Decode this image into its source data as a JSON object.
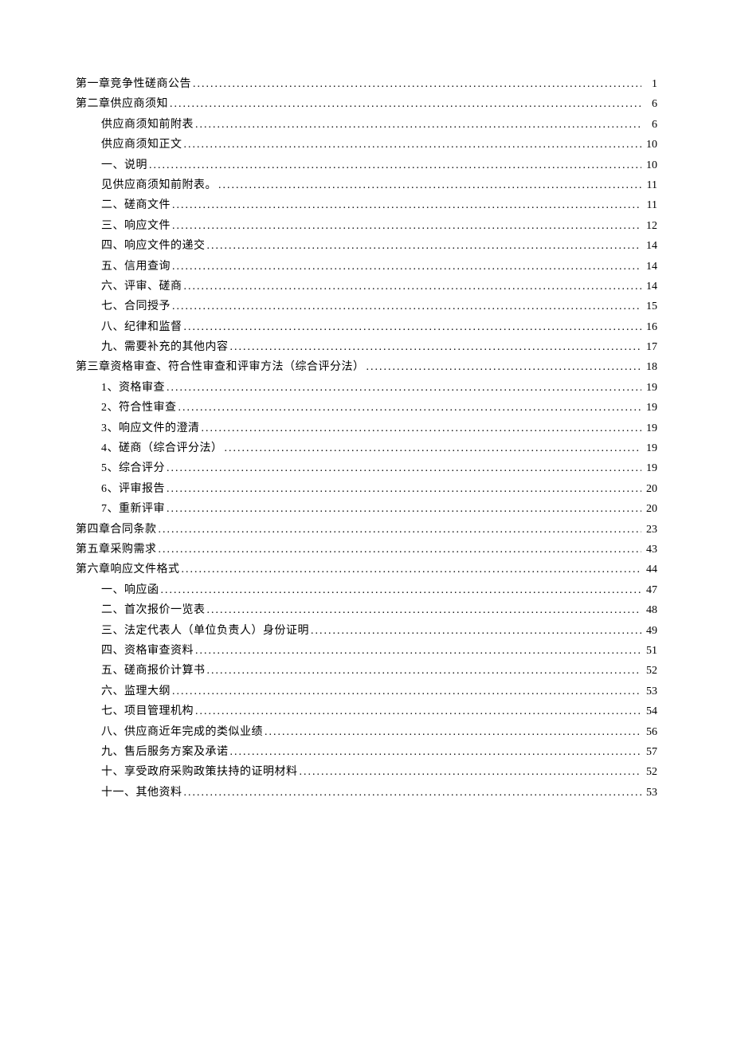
{
  "toc": [
    {
      "level": 0,
      "title": "第一章竞争性磋商公告",
      "page": "1"
    },
    {
      "level": 0,
      "title": "第二章供应商须知",
      "page": "6"
    },
    {
      "level": 1,
      "title": "供应商须知前附表",
      "page": "6"
    },
    {
      "level": 1,
      "title": "供应商须知正文",
      "page": "10"
    },
    {
      "level": 1,
      "title": "一、说明",
      "page": "10"
    },
    {
      "level": 1,
      "title": "见供应商须知前附表。",
      "page": "11"
    },
    {
      "level": 1,
      "title": "二、磋商文件",
      "page": "11"
    },
    {
      "level": 1,
      "title": "三、响应文件",
      "page": "12"
    },
    {
      "level": 1,
      "title": "四、响应文件的递交",
      "page": "14"
    },
    {
      "level": 1,
      "title": "五、信用查询",
      "page": "14"
    },
    {
      "level": 1,
      "title": "六、评审、磋商",
      "page": "14"
    },
    {
      "level": 1,
      "title": "七、合同授予",
      "page": "15"
    },
    {
      "level": 1,
      "title": "八、纪律和监督",
      "page": "16"
    },
    {
      "level": 1,
      "title": "九、需要补充的其他内容",
      "page": "17"
    },
    {
      "level": 0,
      "title": "第三章资格审查、符合性审查和评审方法（综合评分法）",
      "page": "18"
    },
    {
      "level": 1,
      "title": "1、资格审查",
      "page": "19"
    },
    {
      "level": 1,
      "title": "2、符合性审查",
      "page": "19"
    },
    {
      "level": 1,
      "title": "3、响应文件的澄清",
      "page": "19"
    },
    {
      "level": 1,
      "title": "4、磋商（综合评分法）",
      "page": "19"
    },
    {
      "level": 1,
      "title": "5、综合评分",
      "page": "19"
    },
    {
      "level": 1,
      "title": "6、评审报告",
      "page": "20"
    },
    {
      "level": 1,
      "title": "7、重新评审",
      "page": "20"
    },
    {
      "level": 0,
      "title": "第四章合同条款",
      "page": "23"
    },
    {
      "level": 0,
      "title": "第五章采购需求",
      "page": "43"
    },
    {
      "level": 0,
      "title": "第六章响应文件格式",
      "page": "44"
    },
    {
      "level": 1,
      "title": "一、响应函",
      "page": "47"
    },
    {
      "level": 1,
      "title": "二、首次报价一览表",
      "page": "48"
    },
    {
      "level": 1,
      "title": "三、法定代表人（单位负责人）身份证明",
      "page": "49"
    },
    {
      "level": 1,
      "title": "四、资格审查资料",
      "page": "51"
    },
    {
      "level": 1,
      "title": "五、磋商报价计算书",
      "page": "52"
    },
    {
      "level": 1,
      "title": "六、监理大纲",
      "page": "53"
    },
    {
      "level": 1,
      "title": "七、项目管理机构",
      "page": "54"
    },
    {
      "level": 1,
      "title": "八、供应商近年完成的类似业绩",
      "page": "56"
    },
    {
      "level": 1,
      "title": "九、售后服务方案及承诺",
      "page": "57"
    },
    {
      "level": 1,
      "title": "十、享受政府采购政策扶持的证明材料",
      "page": "52"
    },
    {
      "level": 1,
      "title": "十一、其他资料",
      "page": "53"
    }
  ]
}
